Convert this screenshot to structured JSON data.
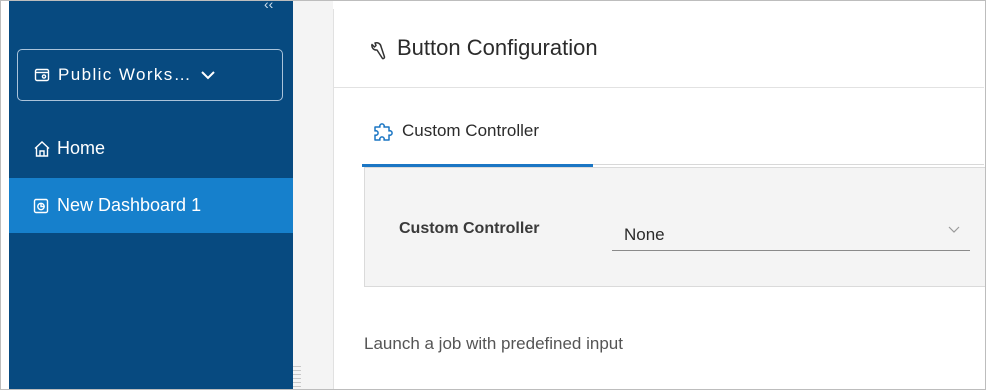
{
  "sidebar": {
    "workspace": {
      "label": "Public Works…",
      "icon": "workspace-icon"
    },
    "items": [
      {
        "label": "Home",
        "icon": "home-icon",
        "active": false
      },
      {
        "label": "New Dashboard 1",
        "icon": "dashboard-icon",
        "active": true
      }
    ]
  },
  "panel": {
    "title": "Button Configuration",
    "title_icon": "wrench-icon",
    "tabs": [
      {
        "label": "Custom Controller",
        "icon": "puzzle-icon",
        "active": true
      }
    ],
    "form": {
      "field_label": "Custom Controller",
      "select_value": "None"
    },
    "description": "Launch a job with predefined input"
  },
  "colors": {
    "sidebar_bg": "#074a80",
    "sidebar_active": "#1680cc",
    "tab_underline": "#1b76c4",
    "accent_icon": "#1b76c4"
  }
}
